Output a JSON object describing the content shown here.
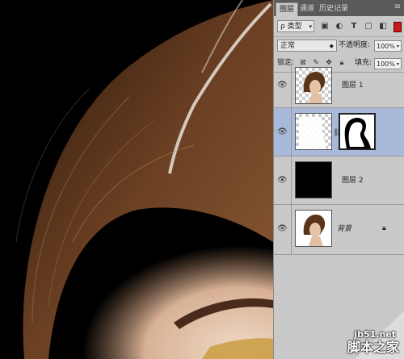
{
  "panel": {
    "tabs": [
      {
        "label": "图层"
      },
      {
        "label": "通道"
      },
      {
        "label": "历史记录"
      }
    ],
    "filter": {
      "kind_label": "ρ 类型",
      "icons": [
        "image-filter-icon",
        "adjustment-filter-icon",
        "type-filter-icon",
        "shape-filter-icon",
        "smart-object-filter-icon"
      ]
    },
    "blend": {
      "mode": "正常",
      "opacity_label": "不透明度:",
      "opacity_value": "100%"
    },
    "lock": {
      "label": "锁定:",
      "fill_label": "填充:",
      "fill_value": "100%"
    },
    "layers": [
      {
        "name": "图层 1",
        "visible": true,
        "thumb": "portrait-cutout"
      },
      {
        "name": "",
        "visible": true,
        "thumb": "mask",
        "selected": true
      },
      {
        "name": "图层 2",
        "visible": true,
        "thumb": "black-fill"
      },
      {
        "name": "背景",
        "visible": true,
        "thumb": "portrait",
        "locked": true
      }
    ]
  },
  "watermark": {
    "url": "jb51.net",
    "site": "脚本之家"
  },
  "colors": {
    "panel_bg": "#c9c9c9",
    "selected_layer": "#a9b9d9",
    "tab_bar": "#5a5a5a"
  }
}
